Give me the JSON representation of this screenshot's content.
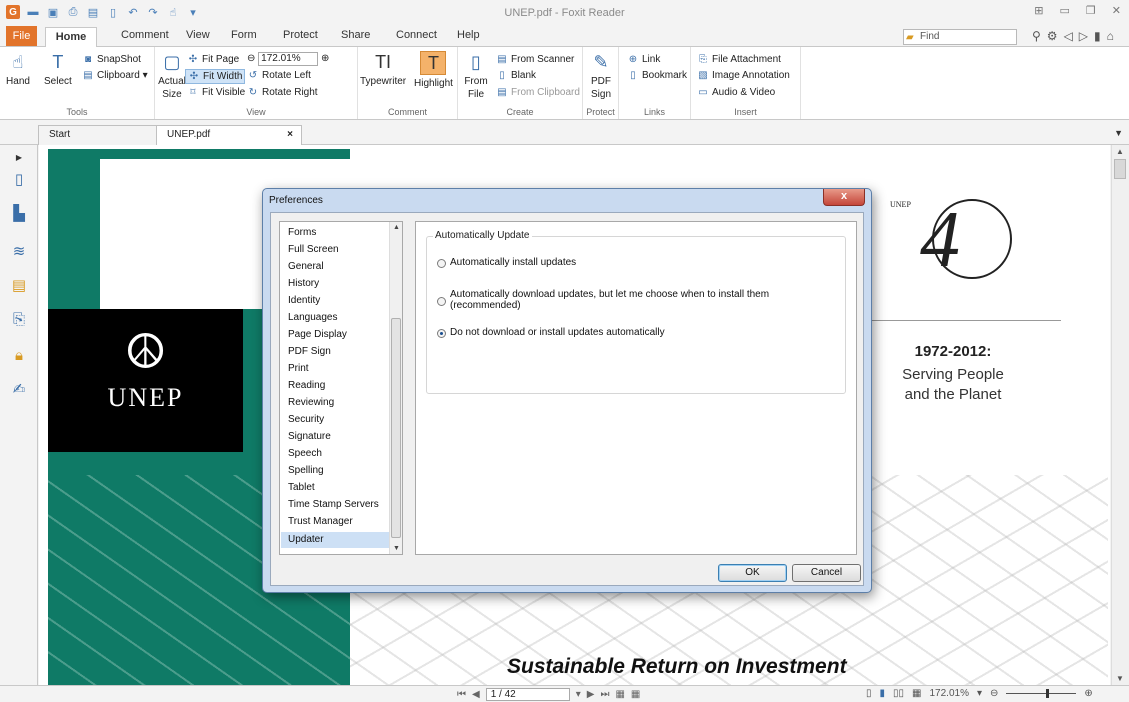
{
  "window": {
    "title": "UNEP.pdf - Foxit Reader"
  },
  "menu": {
    "tabs": [
      "File",
      "Home",
      "Comment",
      "View",
      "Form",
      "Protect",
      "Share",
      "Connect",
      "Help"
    ]
  },
  "find": {
    "placeholder": "Find"
  },
  "ribbon": {
    "tools": {
      "label": "Tools",
      "hand": "Hand",
      "select": "Select",
      "snapshot": "SnapShot",
      "clipboard": "Clipboard"
    },
    "view": {
      "label": "View",
      "actual_size": "Actual Size",
      "fit_page": "Fit Page",
      "fit_width": "Fit Width",
      "fit_visible": "Fit Visible",
      "zoom": "172.01%",
      "rotate_left": "Rotate Left",
      "rotate_right": "Rotate Right"
    },
    "comment": {
      "label": "Comment",
      "typewriter": "Typewriter",
      "highlight": "Highlight"
    },
    "create": {
      "label": "Create",
      "from_file": "From File",
      "from_scanner": "From Scanner",
      "blank": "Blank",
      "from_clipboard": "From Clipboard"
    },
    "protect": {
      "label": "Protect",
      "pdf_sign": "PDF Sign"
    },
    "links": {
      "label": "Links",
      "link": "Link",
      "bookmark": "Bookmark"
    },
    "insert": {
      "label": "Insert",
      "file_attachment": "File Attachment",
      "image_annotation": "Image Annotation",
      "audio_video": "Audio & Video"
    }
  },
  "doc_tabs": [
    {
      "label": "Start"
    },
    {
      "label": "UNEP.pdf",
      "close": "×"
    }
  ],
  "document": {
    "unep_text": "UNEP",
    "unep_small": "UNEP",
    "years": "1972-2012:",
    "serving_line1": "Serving People",
    "serving_line2": "and the Planet",
    "bottom_title": "Sustainable Return on Investment"
  },
  "dialog": {
    "title": "Preferences",
    "close": "x",
    "categories": [
      "Forms",
      "Full Screen",
      "General",
      "History",
      "Identity",
      "Languages",
      "Page Display",
      "PDF Sign",
      "Print",
      "Reading",
      "Reviewing",
      "Security",
      "Signature",
      "Speech",
      "Spelling",
      "Tablet",
      "Time Stamp Servers",
      "Trust Manager",
      "Updater"
    ],
    "selected_category": "Updater",
    "group_title": "Automatically Update",
    "options": [
      {
        "label": "Automatically install updates",
        "checked": false
      },
      {
        "label": "Automatically download updates, but let me choose when to install them (recommended)",
        "checked": false
      },
      {
        "label": "Do not download or install updates automatically",
        "checked": true
      }
    ],
    "ok": "OK",
    "cancel": "Cancel"
  },
  "status": {
    "page": "1 / 42",
    "zoom": "172.01%"
  }
}
